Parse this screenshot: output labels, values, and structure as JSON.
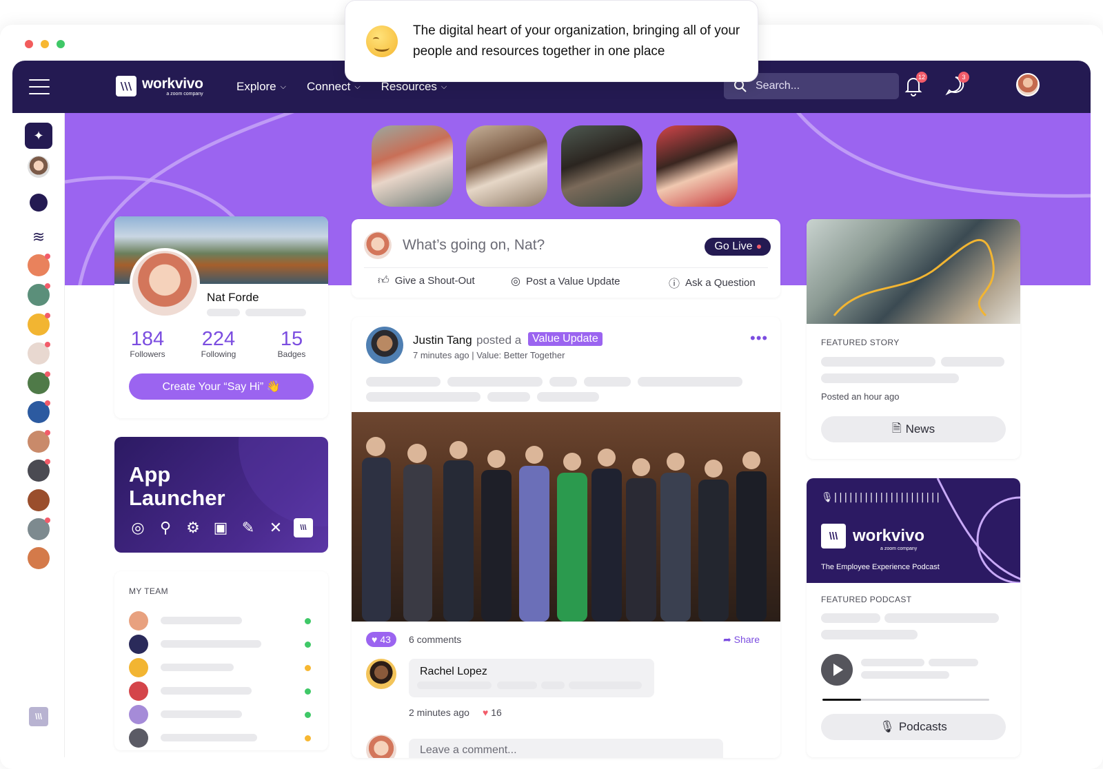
{
  "window": {
    "dot_colors": [
      "#f25c5c",
      "#f7b731",
      "#3fc867"
    ]
  },
  "colors": {
    "brand_dark": "#241a52",
    "accent": "#9b64f0",
    "online": "#3fc867",
    "away": "#f7b731"
  },
  "tooltip": {
    "text": "The digital heart of your organization, bringing all of your people and resources together in one place"
  },
  "topbar": {
    "brand_name": "workvivo",
    "brand_sub": "a zoom company",
    "nav": [
      {
        "label": "Explore"
      },
      {
        "label": "Connect"
      },
      {
        "label": "Resources"
      }
    ],
    "search_placeholder": "Search...",
    "notifications_count": "12",
    "messages_count": "3"
  },
  "profile": {
    "name": "Nat Forde",
    "stats": [
      {
        "value": "184",
        "label": "Followers"
      },
      {
        "value": "224",
        "label": "Following"
      },
      {
        "value": "15",
        "label": "Badges"
      }
    ],
    "say_hi_label": "Create Your “Say Hi” 👋"
  },
  "app_launcher": {
    "title": "App Launcher"
  },
  "my_team": {
    "label": "MY TEAM",
    "members": [
      {
        "status": "online"
      },
      {
        "status": "online"
      },
      {
        "status": "away"
      },
      {
        "status": "online"
      },
      {
        "status": "online"
      },
      {
        "status": "away"
      }
    ]
  },
  "composer": {
    "placeholder": "What’s going on, Nat?",
    "go_live": "Go Live",
    "actions": [
      {
        "label": "Give a Shout-Out",
        "icon": "thumbs-up-icon"
      },
      {
        "label": "Post a Value Update",
        "icon": "target-icon"
      },
      {
        "label": "Ask a Question",
        "icon": "question-icon"
      }
    ]
  },
  "post": {
    "author": "Justin Tang",
    "verb": "posted a",
    "chip": "Value Update",
    "meta": "7 minutes ago | Value: Better Together",
    "reactions": "43",
    "comments": "6 comments",
    "share": "Share",
    "comment": {
      "author": "Rachel Lopez",
      "time": "2 minutes ago",
      "likes": "16"
    },
    "leave_placeholder": "Leave a comment..."
  },
  "featured_story": {
    "label": "FEATURED STORY",
    "posted": "Posted an hour ago",
    "button": "News"
  },
  "featured_podcast": {
    "brand": "workvivo",
    "brand_sub": "a zoom company",
    "tagline": "The Employee Experience Podcast",
    "label": "FEATURED PODCAST",
    "progress": 0.23,
    "button": "Podcasts"
  }
}
